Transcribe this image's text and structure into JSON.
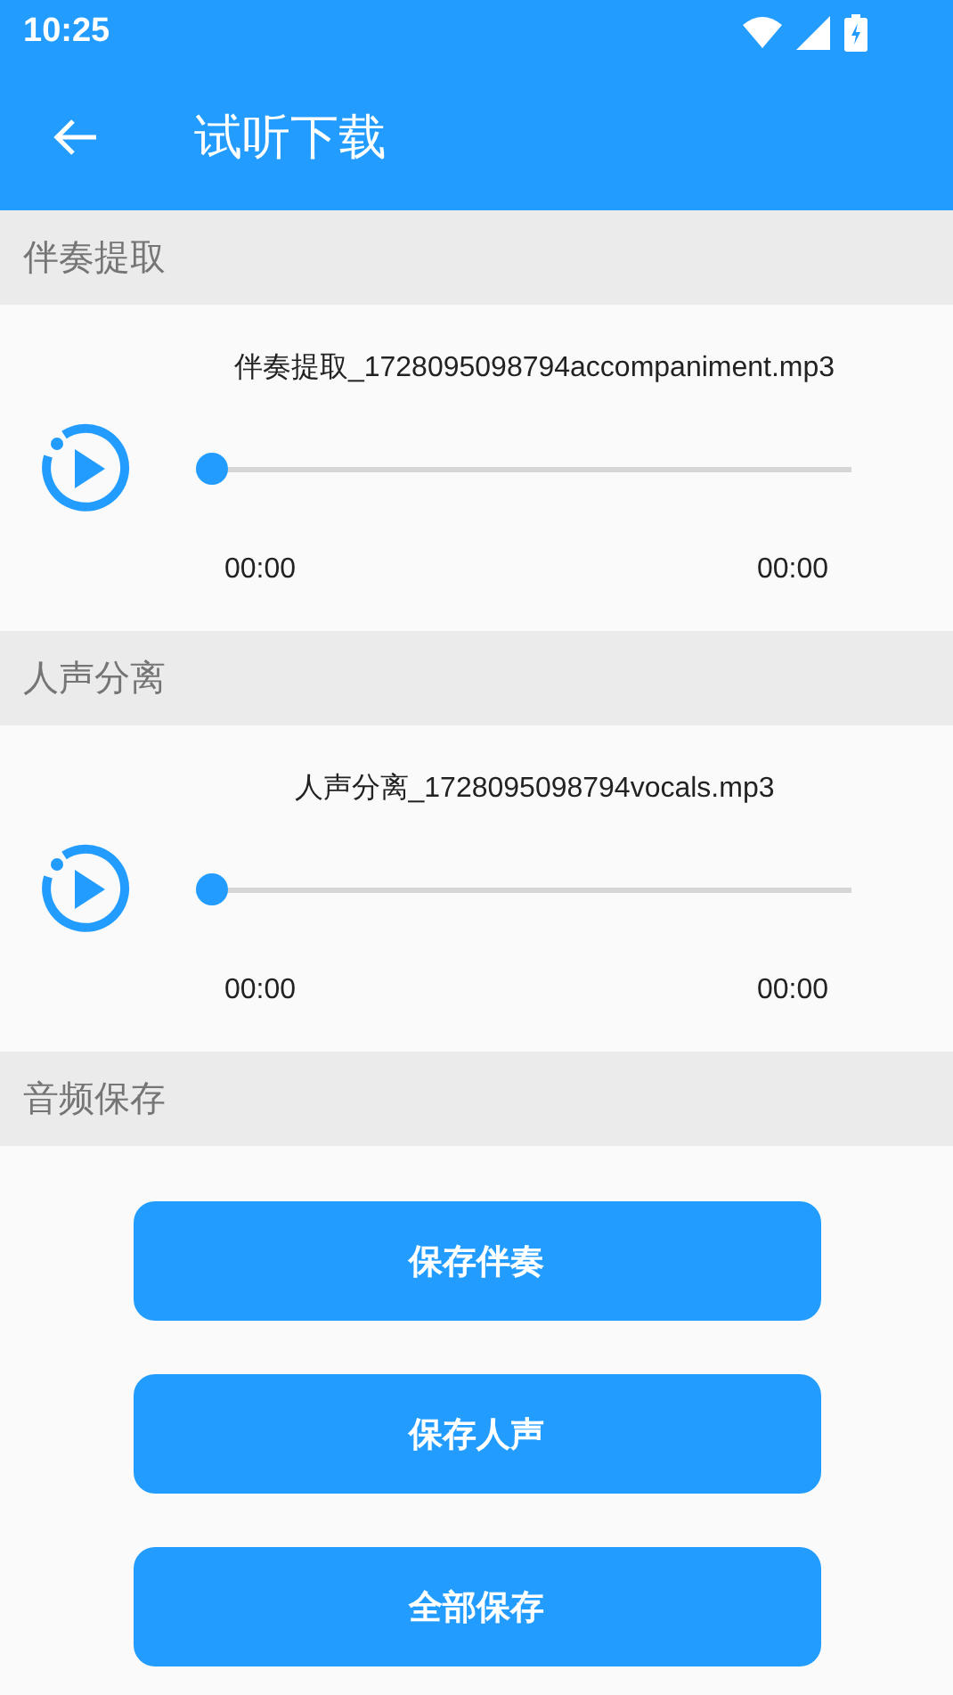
{
  "status_bar": {
    "time": "10:25"
  },
  "toolbar": {
    "title": "试听下载"
  },
  "sections": [
    {
      "header": "伴奏提取",
      "player": {
        "file_name": "伴奏提取_1728095098794accompaniment.mp3",
        "level": 0,
        "elapsed": "00:00",
        "duration": "00:00"
      }
    },
    {
      "header": "人声分离",
      "player": {
        "file_name": "人声分离_1728095098794vocals.mp3",
        "level": 0,
        "elapsed": "00:00",
        "duration": "00:00"
      }
    },
    {
      "header": "音频保存",
      "buttons": [
        "保存伴奏",
        "保存人声",
        "全部保存"
      ]
    }
  ]
}
